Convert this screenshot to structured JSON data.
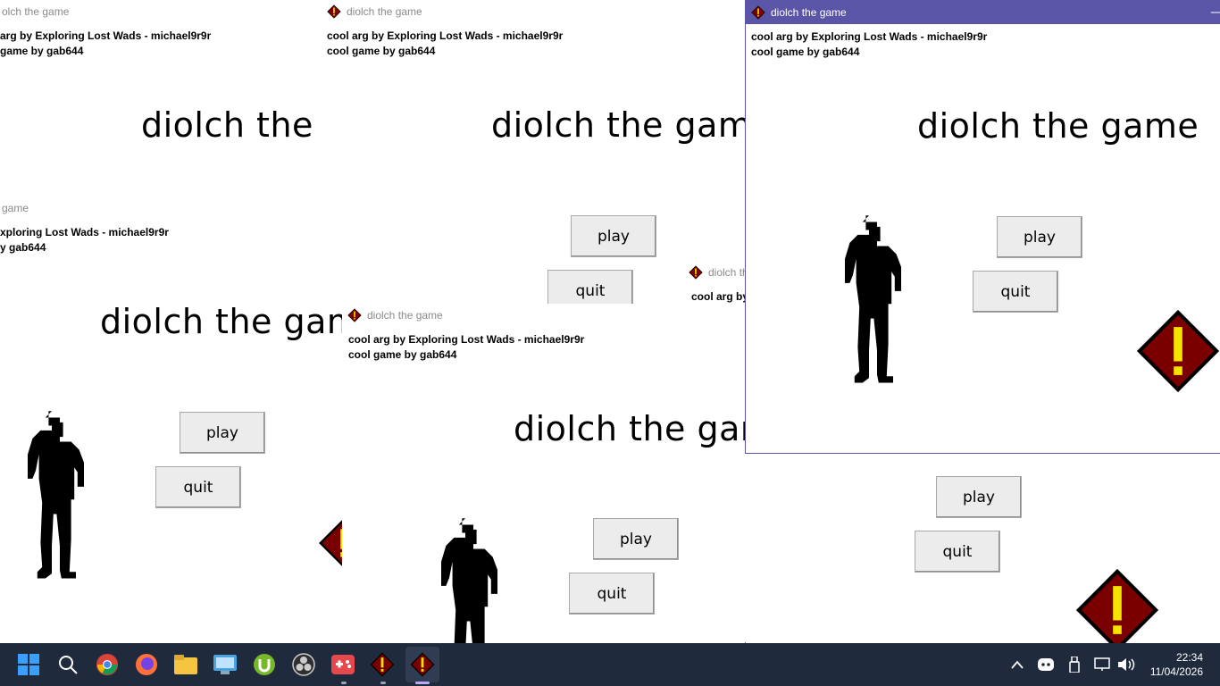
{
  "windows": {
    "title": "diolch the game",
    "title_partial_1": "olch the game",
    "title_partial_2": "game",
    "title_partial_3": "diolch th",
    "credit_1": "cool arg by Exploring Lost Wads - michael9r9r",
    "credit_2": "cool game by gab644",
    "credit_1_partial_a": "arg by Exploring Lost Wads - michael9r9r",
    "credit_2_partial_a": "game by gab644",
    "credit_1_partial_b": "xploring Lost Wads - michael9r9r",
    "credit_2_partial_b": "y gab644",
    "credit_1_partial_c": "cool arg by",
    "heading": "diolch the game",
    "heading_partial_1": "diolch the g",
    "heading_partial_2": "diolch the game",
    "play_label": "play",
    "quit_label": "quit"
  },
  "taskbar": {
    "time": "22:34",
    "date": "11/04/2026",
    "icons": [
      "windows-start-icon",
      "search-icon",
      "chrome-icon",
      "firefox-icon",
      "file-explorer-icon",
      "control-panel-icon",
      "utorrent-icon",
      "obs-icon",
      "game-controller-icon",
      "diolch-game-icon",
      "diolch-game-icon"
    ]
  },
  "colors": {
    "active_titlebar": "#5b55a8",
    "warning_red": "#7a0000",
    "warning_yellow": "#f5e400",
    "taskbar": "#1f2b3c"
  }
}
